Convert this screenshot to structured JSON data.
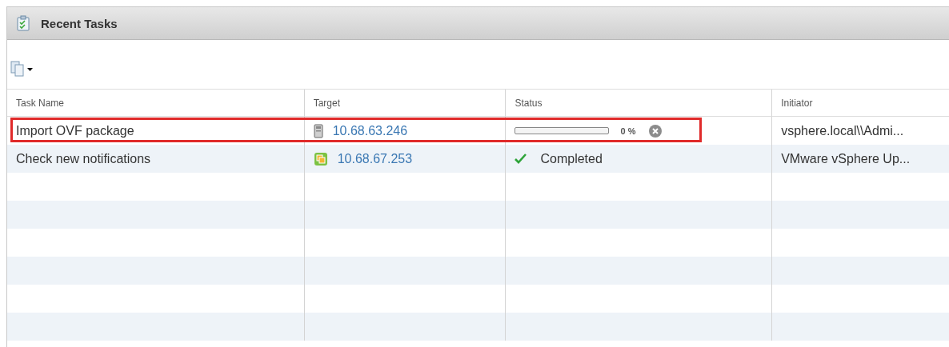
{
  "panel": {
    "title": "Recent Tasks"
  },
  "table": {
    "columns": [
      "Task Name",
      "Target",
      "Status",
      "Initiator"
    ],
    "rows": [
      {
        "task_name": "Import OVF package",
        "target": {
          "kind": "host",
          "text": "10.68.63.246"
        },
        "status": {
          "kind": "progress",
          "level": 0,
          "reading": "0 %"
        },
        "initiator": "vsphere.local\\\\Admi...",
        "highlighted": true
      },
      {
        "task_name": "Check new notifications",
        "target": {
          "kind": "vcenter",
          "text": "10.68.67.253"
        },
        "status": {
          "kind": "completed",
          "text": "Completed"
        },
        "initiator": "VMware vSphere Up...",
        "highlighted": false
      }
    ]
  }
}
